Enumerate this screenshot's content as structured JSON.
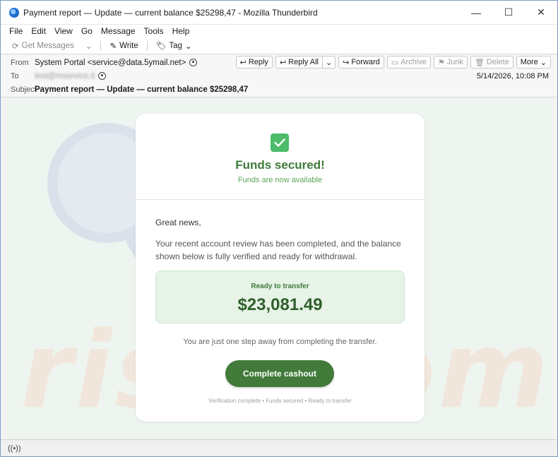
{
  "window": {
    "title": "Payment report — Update — current balance $25298,47 - Mozilla Thunderbird",
    "controls": {
      "minimize": "—",
      "maximize": "☐",
      "close": "✕"
    }
  },
  "menubar": [
    "File",
    "Edit",
    "View",
    "Go",
    "Message",
    "Tools",
    "Help"
  ],
  "toolbar": {
    "get_messages": "Get Messages",
    "write": "Write",
    "tag": "Tag"
  },
  "header": {
    "from_label": "From",
    "from_value": "System Portal <service@data.5ymail.net>",
    "to_label": "To",
    "to_value": "test@mservice.it",
    "subject_label": "Subject",
    "subject_value": "Payment report — Update — current balance $25298,47",
    "date": "5/14/2026, 10:08 PM",
    "actions": {
      "reply": "Reply",
      "reply_all": "Reply All",
      "forward": "Forward",
      "archive": "Archive",
      "junk": "Junk",
      "delete": "Delete",
      "more": "More"
    }
  },
  "email": {
    "title": "Funds secured!",
    "subtitle": "Funds are now available",
    "greeting": "Great news,",
    "paragraph": "Your recent account review has been completed, and the balance shown below is fully verified and ready for withdrawal.",
    "balance_label": "Ready to transfer",
    "balance_amount": "$23,081.49",
    "step_text": "You are just one step away from completing the transfer.",
    "cta": "Complete cashout",
    "footer": "Verification complete • Funds secured • Ready to transfer"
  },
  "watermark": "risk.com",
  "colors": {
    "accent_green": "#417a39",
    "title_green": "#3e7a3b",
    "check_green": "#4cbb6a"
  }
}
